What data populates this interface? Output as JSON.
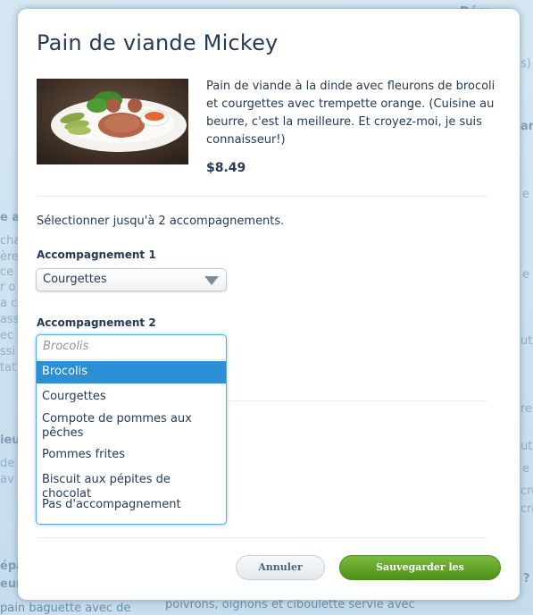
{
  "background": {
    "fragments": [
      "e au",
      "cha",
      "ère,",
      "ce",
      "r o",
      "a co",
      "ass",
      "ec",
      "ssi",
      "tat",
      "ieu",
      "de",
      "av",
      "épa",
      "eur",
      "Déca",
      "s)",
      "anc",
      "e",
      "e",
      "ute",
      "re",
      "ute",
      "e",
      "cré",
      "cre",
      "?"
    ],
    "bottom_left": "pain baguette avec de",
    "bottom_center": "poivrons, oignons et ciboulette servie avec"
  },
  "modal": {
    "title": "Pain de viande Mickey",
    "description": "Pain de viande à la dinde avec fleurons de brocoli et courgettes avec trempette orange. (Cuisine au beurre, c'est la meilleure. Et croyez-moi, je suis connaisseur!)",
    "price": "$8.49",
    "instruction": "Sélectionner jusqu'à 2 accompagnements.",
    "side1": {
      "label": "Accompagnement 1",
      "value": "Courgettes"
    },
    "side2": {
      "label": "Accompagnement 2",
      "placeholder": "Brocolis",
      "options": [
        "Brocolis",
        "Courgettes",
        "Compote de pommes aux pêches",
        "Pommes frites",
        "Biscuit aux pépites de chocolat",
        "Pas d'accompagnement"
      ],
      "highlighted": "Brocolis"
    },
    "buttons": {
      "cancel": "Annuler",
      "save": "Sauvegarder les modifications"
    }
  },
  "colors": {
    "primary_text": "#253b56",
    "highlight": "#2a8fd4",
    "save_button": "#5ea52a"
  }
}
